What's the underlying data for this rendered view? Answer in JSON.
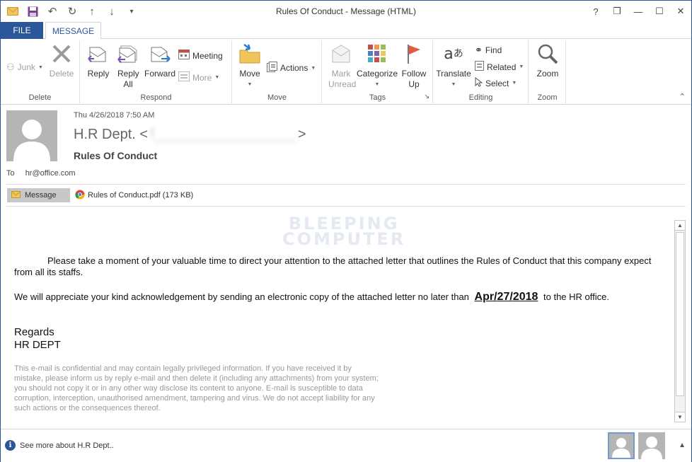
{
  "window": {
    "title": "Rules Of Conduct - Message (HTML)",
    "controls": [
      "?",
      "❐",
      "—",
      "☐",
      "✕"
    ]
  },
  "tabs": {
    "file": "FILE",
    "message": "MESSAGE"
  },
  "ribbon": {
    "delete_group": {
      "label": "Delete",
      "junk": "Junk",
      "delete": "Delete"
    },
    "respond_group": {
      "label": "Respond",
      "reply": "Reply",
      "reply_all": "Reply All",
      "forward": "Forward",
      "meeting": "Meeting",
      "more": "More"
    },
    "move_group": {
      "label": "Move",
      "move": "Move",
      "actions": "Actions"
    },
    "tags_group": {
      "label": "Tags",
      "mark_unread": "Mark Unread",
      "categorize": "Categorize",
      "follow_up": "Follow Up"
    },
    "editing_group": {
      "label": "Editing",
      "translate": "Translate",
      "find": "Find",
      "related": "Related",
      "select": "Select"
    },
    "zoom_group": {
      "label": "Zoom",
      "zoom": "Zoom"
    }
  },
  "message": {
    "sent": "Thu 4/26/2018 7:50 AM",
    "from_name": "H.R Dept.",
    "from_email": "f__________________",
    "subject": "Rules Of Conduct",
    "to_label": "To",
    "to": "hr@office.com",
    "attachments": {
      "message_tab": "Message",
      "file": "Rules of Conduct.pdf (173 KB)"
    },
    "watermark_line1": "BLEEPING",
    "watermark_line2": "COMPUTER",
    "paragraph1": "Please take a moment of your valuable time to direct your attention to the attached letter that outlines the Rules of Conduct that this company expect from all its staffs.",
    "paragraph2_before": "We will appreciate your kind acknowledgement by sending an electronic copy of the attached letter no later than",
    "paragraph2_date": "Apr/27/2018",
    "paragraph2_after": "to the HR office.",
    "regards": "Regards",
    "signature": "HR DEPT",
    "disclaimer": "This e-mail is confidential and may contain legally privileged information. If you have received it by mistake, please inform us by reply e-mail and then delete it (including any attachments) from your system; you should not copy it or in any other way disclose its content to anyone. E-mail is susceptible to data corruption, interception, unauthorised amendment, tampering and virus. We do not accept liability for any such actions or the consequences thereof."
  },
  "people_pane": {
    "text": "See more about H.R Dept.."
  },
  "colors": {
    "accent": "#2b579a",
    "file_tab": "#2b579a"
  }
}
